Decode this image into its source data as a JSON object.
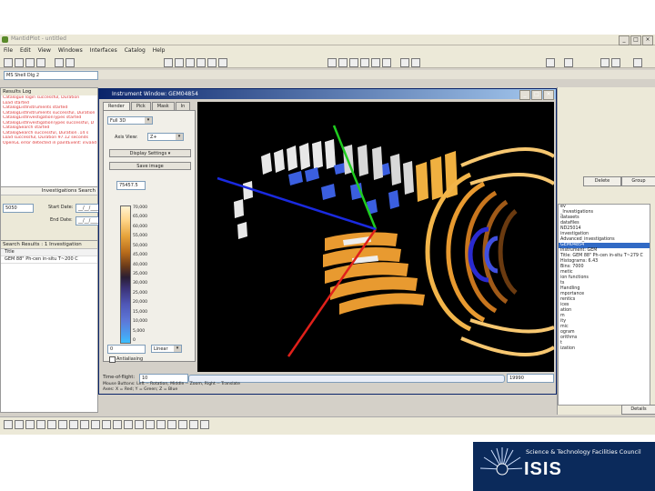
{
  "app": {
    "title": "MantidPlot - untitled",
    "menus": [
      "File",
      "Edit",
      "View",
      "Windows",
      "Interfaces",
      "Catalog",
      "Help"
    ],
    "script_dropdown": "MS Shell Dlg 2"
  },
  "results_log": {
    "title": "Results Log",
    "lines": [
      "Catalogue login successful, Duration",
      "Load started",
      "CatalogListInstruments started",
      "CatalogListInstruments successful, Duration",
      "CatalogListInvestigationTypes started",
      "CatalogListInvestigationTypes successful, D",
      "CatalogSearch started",
      "CatalogSearch successful, Duration .14 s",
      "Load successful, Duration 97.12 seconds",
      "OpenGL error detected in paintEvent: invalid"
    ]
  },
  "investigation_search": {
    "title": "Investigations Search",
    "run_value": "5050",
    "start_date_label": "Start Date:",
    "start_date_value": "__/__/____",
    "end_date_label": "End Date:",
    "end_date_value": "__/__/____"
  },
  "search_results": {
    "title": "Search Results : 1 Investigation",
    "column_title": "Title",
    "rows": [
      "GEM 88\" Ph-cen in-situ T~200 C"
    ]
  },
  "instrument_window": {
    "title": "Instrument Window: GEM04854",
    "tabs": [
      "Render",
      "Pick",
      "Mask",
      "In"
    ],
    "view_mode": "Full 3D",
    "axis_view_label": "Axis View:",
    "axis_view_value": "Z+",
    "display_settings": "Display Settings",
    "save_image": "Save image",
    "colorbar_max": "75457.5",
    "colorbar_ticks": [
      "70,000",
      "65,000",
      "60,000",
      "55,000",
      "50,000",
      "45,000",
      "40,000",
      "35,000",
      "30,000",
      "25,000",
      "20,000",
      "15,000",
      "10,000",
      "5,000",
      "0"
    ],
    "scale_min": "0",
    "scale_type": "Linear",
    "antialiasing_label": "Antialiasing",
    "tof_label": "Time-of-flight:",
    "tof_min": "10",
    "tof_max": "19990",
    "legend_line1": "Mouse Buttons: Left -- Rotation, Middle -- Zoom, Right -- Translate",
    "legend_line2": "Axes: X = Red; Y = Green; Z = Blue"
  },
  "right_panel": {
    "delete_button": "Delete",
    "group_button": "Group",
    "details_button": "Details",
    "tree_items": [
      "ev",
      "_Investigations",
      "datasets",
      "datafiles",
      "ND25014",
      "investigation",
      "Advanced_investigations",
      "GEM04854",
      "Instrument: GEM",
      "Title: GEM 88\" Ph-cen in-situ T~279 C",
      "Histograms: 6.43",
      "Bins: 7000",
      "",
      "metic",
      "ion functions",
      "ts",
      "Handling",
      "mportance",
      "rentics",
      "ices",
      "ation",
      "m",
      "ity",
      "mic",
      "ogram",
      "orithms",
      "t",
      "ization"
    ]
  },
  "branding": {
    "council": "Science & Technology Facilities Council",
    "name": "ISIS"
  },
  "colors": {
    "x_axis": "#e0201a",
    "y_axis": "#1fcc1f",
    "z_axis": "#1a2ae0",
    "isis_navy": "#0b2a5b"
  }
}
